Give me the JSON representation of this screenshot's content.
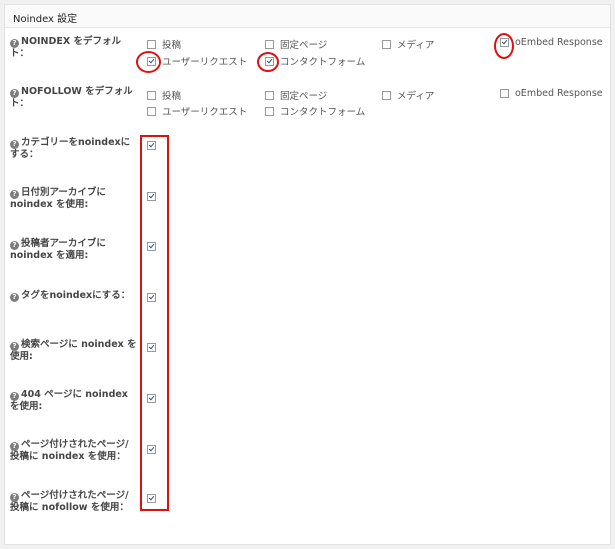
{
  "panel": {
    "title": "Noindex 設定"
  },
  "help_icon": "?",
  "noindex_default": {
    "label": "NOINDEX をデフォルト：",
    "options": [
      {
        "label": "投稿",
        "checked": false
      },
      {
        "label": "固定ページ",
        "checked": false
      },
      {
        "label": "メディア",
        "checked": false
      },
      {
        "label": "oEmbed Response",
        "checked": true
      },
      {
        "label": "ユーザーリクエスト",
        "checked": true
      },
      {
        "label": "コンタクトフォーム",
        "checked": true
      }
    ]
  },
  "nofollow_default": {
    "label": "NOFOLLOW をデフォルト：",
    "options": [
      {
        "label": "投稿",
        "checked": false
      },
      {
        "label": "固定ページ",
        "checked": false
      },
      {
        "label": "メディア",
        "checked": false
      },
      {
        "label": "oEmbed Response",
        "checked": false
      },
      {
        "label": "ユーザーリクエスト",
        "checked": false
      },
      {
        "label": "コンタクトフォーム",
        "checked": false
      }
    ]
  },
  "settings": [
    {
      "label": "カテゴリーをnoindexにする：",
      "checked": true
    },
    {
      "label": "日付別アーカイブに noindex を使用:",
      "checked": true
    },
    {
      "label": "投稿者アーカイブに noindex を適用:",
      "checked": true
    },
    {
      "label": "タグをnoindexにする：",
      "checked": true
    },
    {
      "label": "検索ページに noindex を使用:",
      "checked": true
    },
    {
      "label": "404 ページに noindex を使用:",
      "checked": true
    },
    {
      "label": "ページ付けされたページ/投稿に noindex を使用：",
      "checked": true
    },
    {
      "label": "ページ付けされたページ/投稿に nofollow を使用：",
      "checked": true
    }
  ],
  "annotation_color": "#dd1111"
}
